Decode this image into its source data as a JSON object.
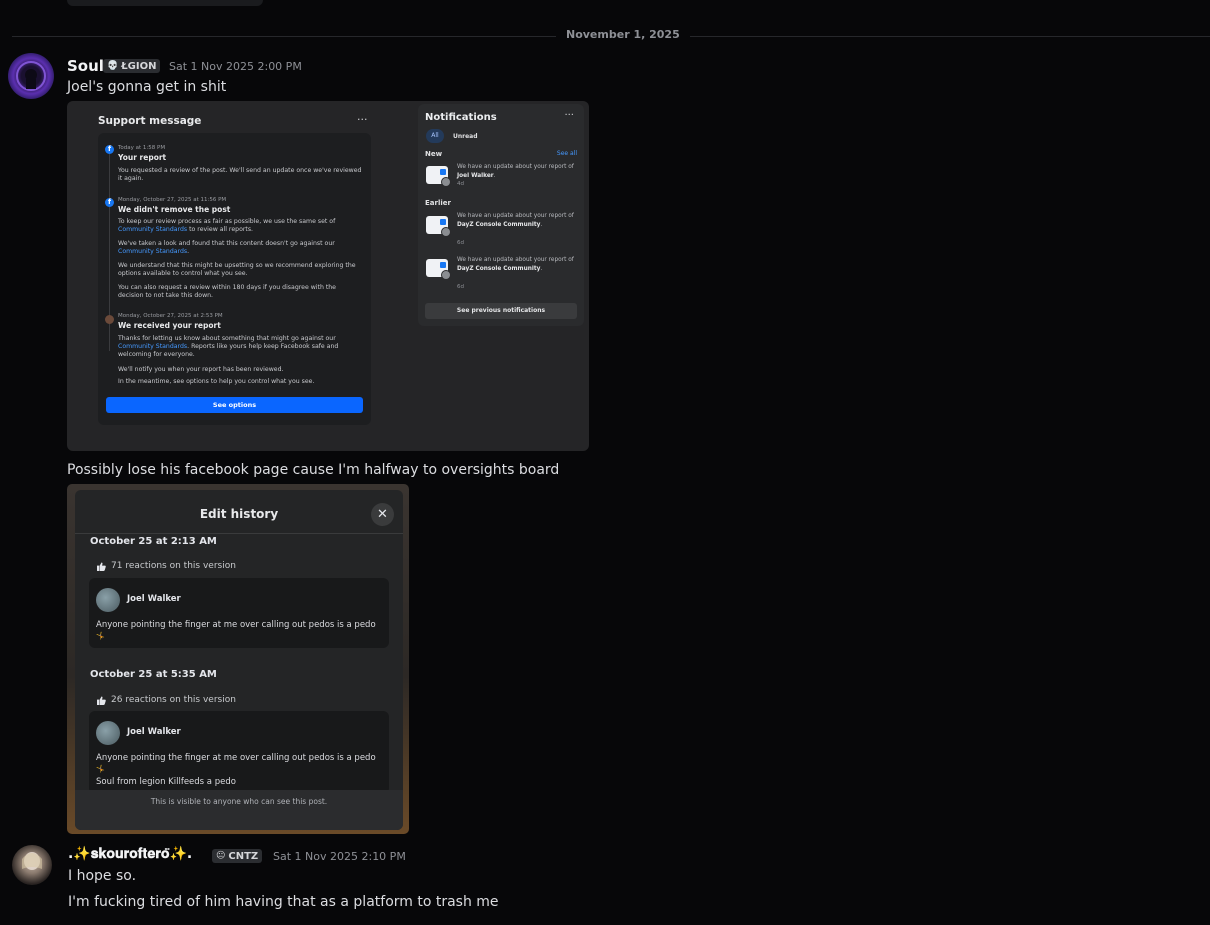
{
  "date_divider": "November 1, 2025",
  "msg1": {
    "username": "Soul",
    "tag": "ŁGION",
    "tag_emoji": "💀",
    "timestamp": "Sat 1 Nov 2025 2:00 PM",
    "line1": "Joel's gonna get in shit",
    "line2": "Possibly lose his facebook page cause I'm halfway to oversights board"
  },
  "shot1": {
    "support": {
      "title": "Support message",
      "more": "···",
      "items": [
        {
          "meta": "Today at 1:58 PM",
          "head": "Your report",
          "body": "You requested a review of the post. We'll send an update once we've reviewed it again."
        },
        {
          "meta": "Monday, October 27, 2025 at 11:56 PM",
          "head": "We didn't remove the post",
          "p1a": "To keep our review process as fair as possible, we use the same set of",
          "p1l": "Community Standards",
          "p1b": " to review all reports.",
          "p2a": "We've taken a look and found that this content doesn't go against our",
          "p2l": "Community Standards",
          "p2b": ".",
          "p3": "We understand that this might be upsetting so we recommend exploring the options available to control what you see.",
          "p4": "You can also request a review within 180 days if you disagree with the decision to not take this down."
        },
        {
          "meta": "Monday, October 27, 2025 at 2:53 PM",
          "head": "We received your report",
          "p1a": "Thanks for letting us know about something that might go against our",
          "p1l": "Community Standards",
          "p1b": ". Reports like yours help keep Facebook safe and welcoming for everyone.",
          "p2": "We'll notify you when your report has been reviewed.",
          "p3": "In the meantime, see options to help you control what you see."
        }
      ],
      "button": "See options"
    },
    "notifications": {
      "title": "Notifications",
      "more": "···",
      "tab_all": "All",
      "tab_unread": "Unread",
      "new_label": "New",
      "see_all": "See all",
      "earlier_label": "Earlier",
      "n1": {
        "pre": "We have an update about your report of ",
        "bold": "Joel Walker",
        "post": ".",
        "age": "4d"
      },
      "n2": {
        "pre": "We have an update about your report of ",
        "bold": "DayZ Console Community",
        "post": ".",
        "age": "6d"
      },
      "n3": {
        "pre": "We have an update about your report of ",
        "bold": "DayZ Console Community",
        "post": ".",
        "age": "6d"
      },
      "prev_button": "See previous notifications"
    }
  },
  "shot2": {
    "title": "Edit history",
    "close": "✕",
    "v1": {
      "date": "October 25 at 2:13 AM",
      "reactions": "71 reactions on this version",
      "name": "Joel Walker",
      "text": "Anyone pointing the finger at me over calling out pedos is a pedo",
      "emoji": "🤸"
    },
    "v2": {
      "date": "October 25 at 5:35 AM",
      "reactions": "26 reactions on this version",
      "name": "Joel Walker",
      "text": "Anyone pointing the finger at me over calling out pedos is a pedo",
      "emoji": "🤸",
      "text2": "Soul from legion Killfeeds a pedo"
    },
    "footer": "This is visible to anyone who can see this post."
  },
  "msg2": {
    "username": ".✨𝐬𝐤𝐨𝐮𝐫𝐨𝐟𝐭𝐞𝐫𝐨̈✨.",
    "tag": "CNTZ",
    "tag_emoji": "😐",
    "timestamp": "Sat 1 Nov 2025 2:10 PM",
    "line1": "I hope so.",
    "line2": "I'm fucking tired of him having that as a platform to trash me"
  }
}
